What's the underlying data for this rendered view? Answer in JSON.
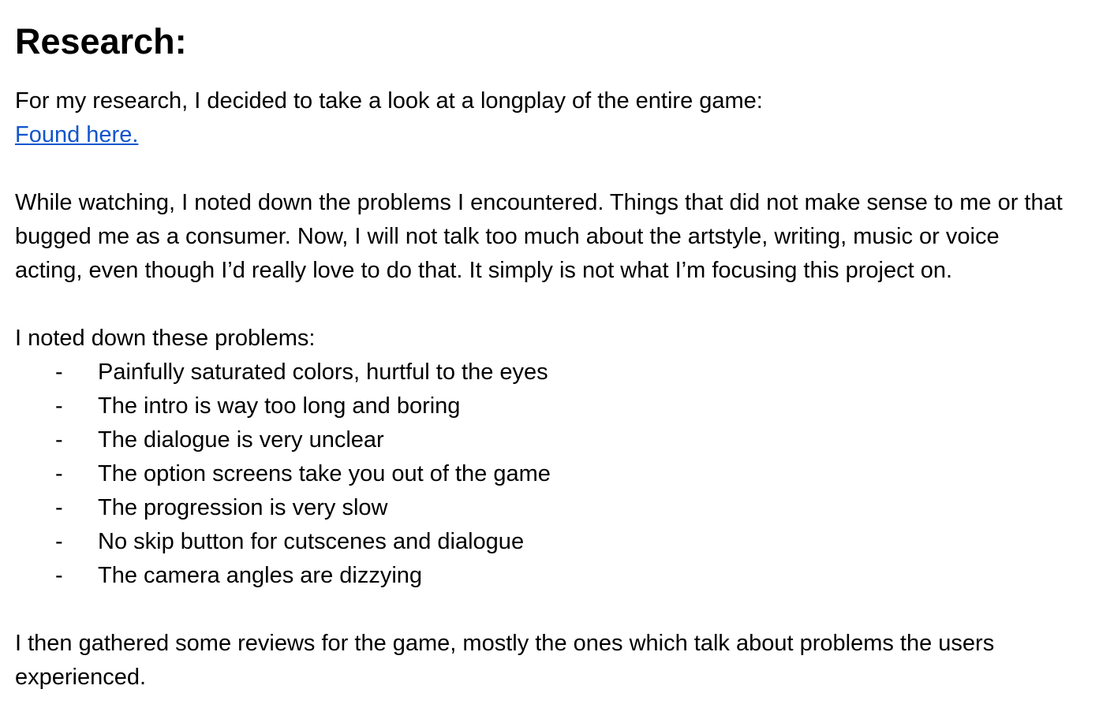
{
  "heading": "Research:",
  "intro": {
    "sentence": "For my research, I decided to take a look at a longplay of the entire game:",
    "link_text": "Found here."
  },
  "paragraph_watching": "While watching, I noted down the problems I encountered. Things that did not make sense to me or that bugged me as a consumer. Now, I will not talk too much about the artstyle, writing, music or voice acting, even though I’d really love to do that. It simply is not what I’m focusing this project on.",
  "problems": {
    "lead": "I noted down these problems:",
    "bullet": "-",
    "items": [
      "Painfully saturated colors, hurtful to the eyes",
      "The intro is way too long and boring",
      "The dialogue is very unclear",
      "The option screens take you out of the game",
      "The progression is very slow",
      "No skip button for cutscenes and dialogue",
      "The camera angles are dizzying"
    ]
  },
  "paragraph_reviews": "I then gathered some reviews for the game, mostly the ones which talk about problems the users experienced.",
  "colors": {
    "link": "#1155cc",
    "text": "#000000",
    "background": "#ffffff"
  }
}
